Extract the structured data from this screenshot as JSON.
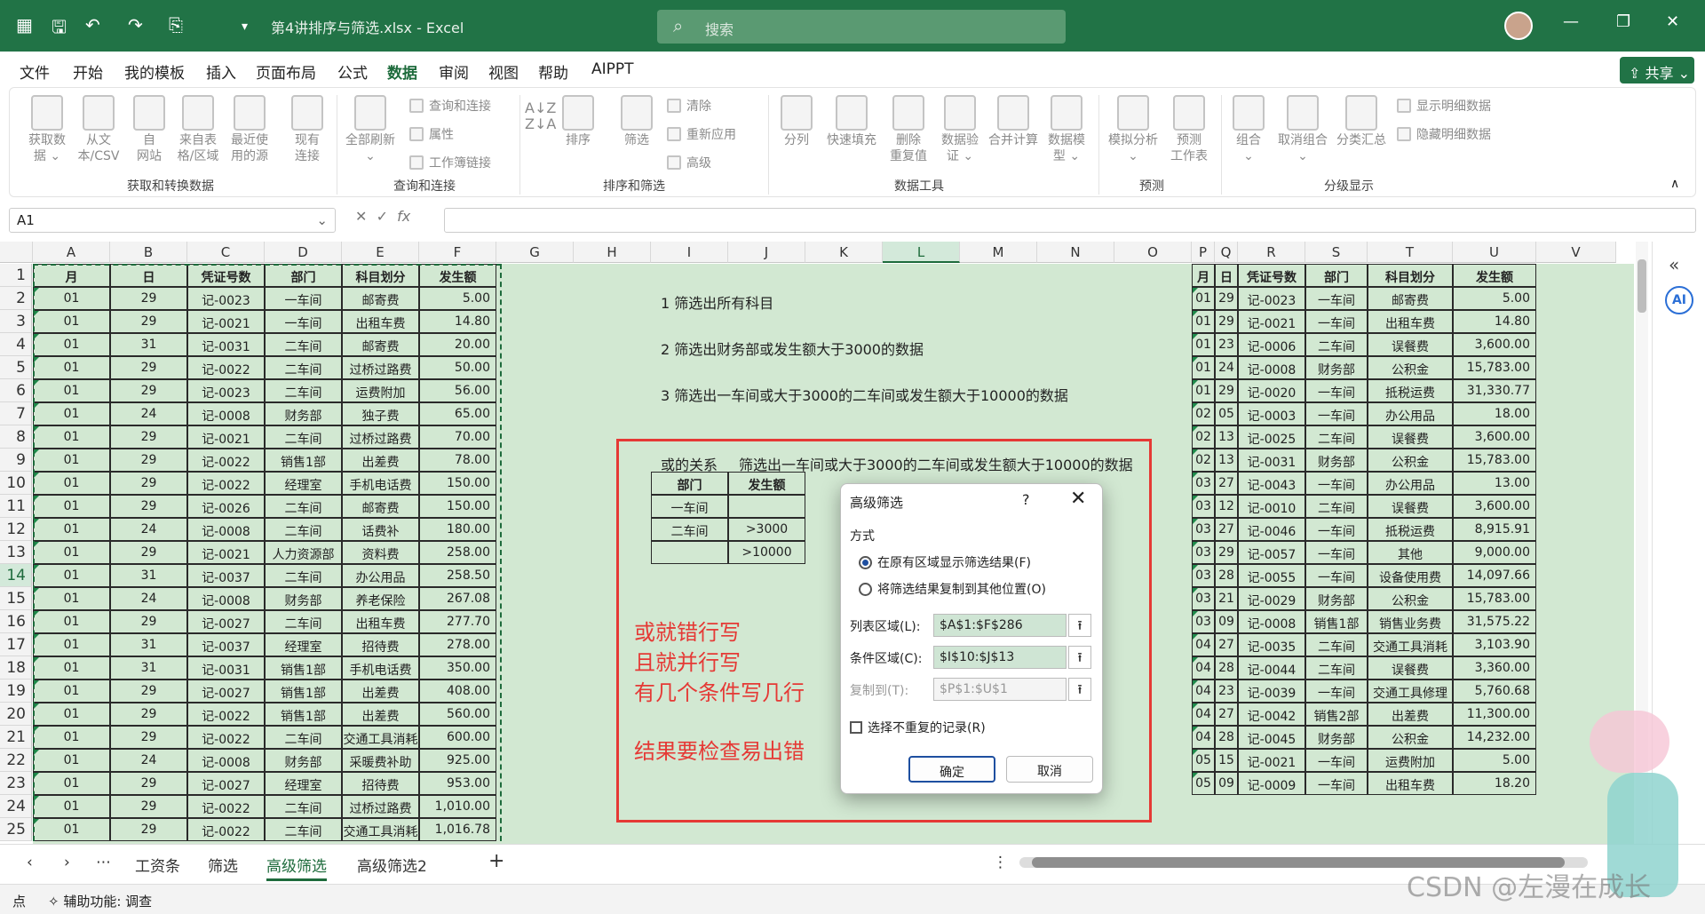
{
  "titlebar": {
    "title": "第4讲排序与筛选.xlsx  -  Excel",
    "search_placeholder": "搜索"
  },
  "menu": [
    "文件",
    "开始",
    "我的模板",
    "插入",
    "页面布局",
    "公式",
    "数据",
    "审阅",
    "视图",
    "帮助",
    "AIPPT"
  ],
  "active_menu": "数据",
  "share_label": "共享",
  "ribbon": {
    "buttons": [
      {
        "label": "获取数\n据 ⌄"
      },
      {
        "label": "从文\n本/CSV"
      },
      {
        "label": "自\n网站"
      },
      {
        "label": "来自表\n格/区域"
      },
      {
        "label": "最近使\n用的源"
      },
      {
        "label": "现有\n连接"
      },
      {
        "label": "全部刷新\n⌄"
      },
      {
        "label": "排序"
      },
      {
        "label": "筛选"
      },
      {
        "label": "分列"
      },
      {
        "label": "快速填充"
      },
      {
        "label": "删除\n重复值"
      },
      {
        "label": "数据验\n证 ⌄"
      },
      {
        "label": "合并计算"
      },
      {
        "label": "数据模\n型 ⌄"
      },
      {
        "label": "模拟分析\n⌄"
      },
      {
        "label": "预测\n工作表"
      },
      {
        "label": "组合\n⌄"
      },
      {
        "label": "取消组合\n⌄"
      },
      {
        "label": "分类汇总"
      }
    ],
    "small": [
      "查询和连接",
      "属性",
      "工作簿链接",
      "清除",
      "重新应用",
      "高级",
      "显示明细数据",
      "隐藏明细数据"
    ],
    "groups": [
      "获取和转换数据",
      "查询和连接",
      "排序和筛选",
      "数据工具",
      "预测",
      "分级显示"
    ]
  },
  "formula_bar": {
    "name_box": "A1",
    "fx": "fx",
    "value": ""
  },
  "columns": [
    "A",
    "B",
    "C",
    "D",
    "E",
    "F",
    "G",
    "H",
    "I",
    "J",
    "K",
    "L",
    "M",
    "N",
    "O",
    "P",
    "Q",
    "R",
    "S",
    "T",
    "U",
    "V"
  ],
  "selected_column": "L",
  "rows": [
    "1",
    "2",
    "3",
    "4",
    "5",
    "6",
    "7",
    "8",
    "9",
    "10",
    "11",
    "12",
    "13",
    "14",
    "15",
    "16",
    "17",
    "18",
    "19",
    "20",
    "21",
    "22",
    "23",
    "24",
    "25"
  ],
  "selected_row": "14",
  "table_left": {
    "headers": [
      "月",
      "日",
      "凭证号数",
      "部门",
      "科目划分",
      "发生额"
    ],
    "rows": [
      [
        "01",
        "29",
        "记-0023",
        "一车间",
        "邮寄费",
        "5.00"
      ],
      [
        "01",
        "29",
        "记-0021",
        "一车间",
        "出租车费",
        "14.80"
      ],
      [
        "01",
        "31",
        "记-0031",
        "二车间",
        "邮寄费",
        "20.00"
      ],
      [
        "01",
        "29",
        "记-0022",
        "二车间",
        "过桥过路费",
        "50.00"
      ],
      [
        "01",
        "29",
        "记-0023",
        "二车间",
        "运费附加",
        "56.00"
      ],
      [
        "01",
        "24",
        "记-0008",
        "财务部",
        "独子费",
        "65.00"
      ],
      [
        "01",
        "29",
        "记-0021",
        "二车间",
        "过桥过路费",
        "70.00"
      ],
      [
        "01",
        "29",
        "记-0022",
        "销售1部",
        "出差费",
        "78.00"
      ],
      [
        "01",
        "29",
        "记-0022",
        "经理室",
        "手机电话费",
        "150.00"
      ],
      [
        "01",
        "29",
        "记-0026",
        "二车间",
        "邮寄费",
        "150.00"
      ],
      [
        "01",
        "24",
        "记-0008",
        "二车间",
        "话费补",
        "180.00"
      ],
      [
        "01",
        "29",
        "记-0021",
        "人力资源部",
        "资料费",
        "258.00"
      ],
      [
        "01",
        "31",
        "记-0037",
        "二车间",
        "办公用品",
        "258.50"
      ],
      [
        "01",
        "24",
        "记-0008",
        "财务部",
        "养老保险",
        "267.08"
      ],
      [
        "01",
        "29",
        "记-0027",
        "二车间",
        "出租车费",
        "277.70"
      ],
      [
        "01",
        "31",
        "记-0037",
        "经理室",
        "招待费",
        "278.00"
      ],
      [
        "01",
        "31",
        "记-0031",
        "销售1部",
        "手机电话费",
        "350.00"
      ],
      [
        "01",
        "29",
        "记-0027",
        "销售1部",
        "出差费",
        "408.00"
      ],
      [
        "01",
        "29",
        "记-0022",
        "销售1部",
        "出差费",
        "560.00"
      ],
      [
        "01",
        "29",
        "记-0022",
        "二车间",
        "交通工具消耗",
        "600.00"
      ],
      [
        "01",
        "24",
        "记-0008",
        "财务部",
        "采暖费补助",
        "925.00"
      ],
      [
        "01",
        "29",
        "记-0027",
        "经理室",
        "招待费",
        "953.00"
      ],
      [
        "01",
        "29",
        "记-0022",
        "二车间",
        "过桥过路费",
        "1,010.00"
      ],
      [
        "01",
        "29",
        "记-0022",
        "二车间",
        "交通工具消耗",
        "1,016.78"
      ]
    ]
  },
  "table_right": {
    "headers": [
      "月",
      "日",
      "凭证号数",
      "部门",
      "科目划分",
      "发生额"
    ],
    "rows": [
      [
        "01",
        "29",
        "记-0023",
        "一车间",
        "邮寄费",
        "5.00"
      ],
      [
        "01",
        "29",
        "记-0021",
        "一车间",
        "出租车费",
        "14.80"
      ],
      [
        "01",
        "23",
        "记-0006",
        "二车间",
        "误餐费",
        "3,600.00"
      ],
      [
        "01",
        "24",
        "记-0008",
        "财务部",
        "公积金",
        "15,783.00"
      ],
      [
        "01",
        "29",
        "记-0020",
        "一车间",
        "抵税运费",
        "31,330.77"
      ],
      [
        "02",
        "05",
        "记-0003",
        "一车间",
        "办公用品",
        "18.00"
      ],
      [
        "02",
        "13",
        "记-0025",
        "二车间",
        "误餐费",
        "3,600.00"
      ],
      [
        "02",
        "13",
        "记-0031",
        "财务部",
        "公积金",
        "15,783.00"
      ],
      [
        "03",
        "27",
        "记-0043",
        "一车间",
        "办公用品",
        "13.00"
      ],
      [
        "03",
        "12",
        "记-0010",
        "二车间",
        "误餐费",
        "3,600.00"
      ],
      [
        "03",
        "27",
        "记-0046",
        "一车间",
        "抵税运费",
        "8,915.91"
      ],
      [
        "03",
        "29",
        "记-0057",
        "一车间",
        "其他",
        "9,000.00"
      ],
      [
        "03",
        "28",
        "记-0055",
        "一车间",
        "设备使用费",
        "14,097.66"
      ],
      [
        "03",
        "21",
        "记-0029",
        "财务部",
        "公积金",
        "15,783.00"
      ],
      [
        "03",
        "09",
        "记-0008",
        "销售1部",
        "销售业务费",
        "31,575.22"
      ],
      [
        "04",
        "27",
        "记-0035",
        "二车间",
        "交通工具消耗",
        "3,103.90"
      ],
      [
        "04",
        "28",
        "记-0044",
        "二车间",
        "误餐费",
        "3,360.00"
      ],
      [
        "04",
        "23",
        "记-0039",
        "一车间",
        "交通工具修理",
        "5,760.68"
      ],
      [
        "04",
        "27",
        "记-0042",
        "销售2部",
        "出差费",
        "11,300.00"
      ],
      [
        "04",
        "28",
        "记-0045",
        "财务部",
        "公积金",
        "14,232.00"
      ],
      [
        "05",
        "15",
        "记-0021",
        "一车间",
        "运费附加",
        "5.00"
      ],
      [
        "05",
        "09",
        "记-0009",
        "一车间",
        "出租车费",
        "18.20"
      ]
    ]
  },
  "notes": [
    "1 筛选出所有科目",
    "2 筛选出财务部或发生额大于3000的数据",
    "3 筛选出一车间或大于3000的二车间或发生额大于10000的数据"
  ],
  "criteria": {
    "label_or": "或的关系",
    "label_desc": "筛选出一车间或大于3000的二车间或发生额大于10000的数据",
    "headers": [
      "部门",
      "发生额"
    ],
    "rows": [
      [
        "一车间",
        ""
      ],
      [
        "二车间",
        ">3000"
      ],
      [
        "",
        ">10000"
      ]
    ]
  },
  "red_notes": [
    "或就错行写",
    "且就并行写",
    "有几个条件写几行",
    "结果要检查易出错"
  ],
  "dialog": {
    "title": "高级筛选",
    "help": "?",
    "close": "✕",
    "section": "方式",
    "radio1": "在原有区域显示筛选结果(F)",
    "radio2": "将筛选结果复制到其他位置(O)",
    "list_label": "列表区域(L):",
    "list_value": "$A$1:$F$286",
    "criteria_label": "条件区域(C):",
    "criteria_value": "$I$10:$J$13",
    "copy_label": "复制到(T):",
    "copy_value": "$P$1:$U$1",
    "unique_label": "选择不重复的记录(R)",
    "ok": "确定",
    "cancel": "取消"
  },
  "sheet_tabs": [
    "工资条",
    "筛选",
    "高级筛选",
    "高级筛选2"
  ],
  "active_tab": "高级筛选",
  "status": {
    "mode": "点",
    "accessibility": "辅助功能: 调查"
  },
  "watermark": "CSDN @左漫在成长",
  "colors": {
    "excel_green": "#217346",
    "sheet_bg": "#d2e8d2",
    "annotation_red": "#e53935"
  }
}
